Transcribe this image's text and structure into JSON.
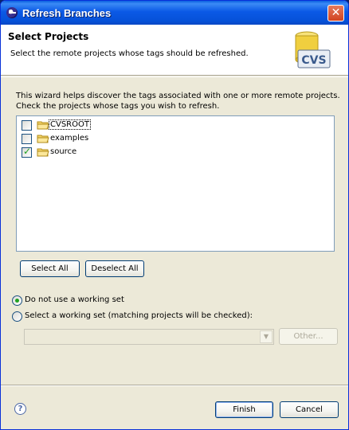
{
  "window": {
    "title": "Refresh Branches"
  },
  "header": {
    "title": "Select Projects",
    "description": "Select the remote projects whose tags should be refreshed.",
    "logo_text": "CVS"
  },
  "wizard_text": {
    "line1": "This wizard helps discover the tags associated with one or more remote projects.",
    "line2": "Check the projects whose tags you wish to refresh."
  },
  "projects": [
    {
      "label": "CVSROOT",
      "checked": false
    },
    {
      "label": "examples",
      "checked": false
    },
    {
      "label": "source",
      "checked": true
    }
  ],
  "buttons": {
    "select_all": "Select All",
    "deselect_all": "Deselect All",
    "other": "Other...",
    "finish": "Finish",
    "cancel": "Cancel"
  },
  "working_set": {
    "option1": "Do not use a working set",
    "option2": "Select a working set (matching projects will be checked):",
    "selected": "option1",
    "combo_value": ""
  },
  "colors": {
    "title_bar": "#0b59e6",
    "dialog_bg": "#ece9d8",
    "check_green": "#21a121",
    "folder_yellow": "#f4d56a"
  }
}
